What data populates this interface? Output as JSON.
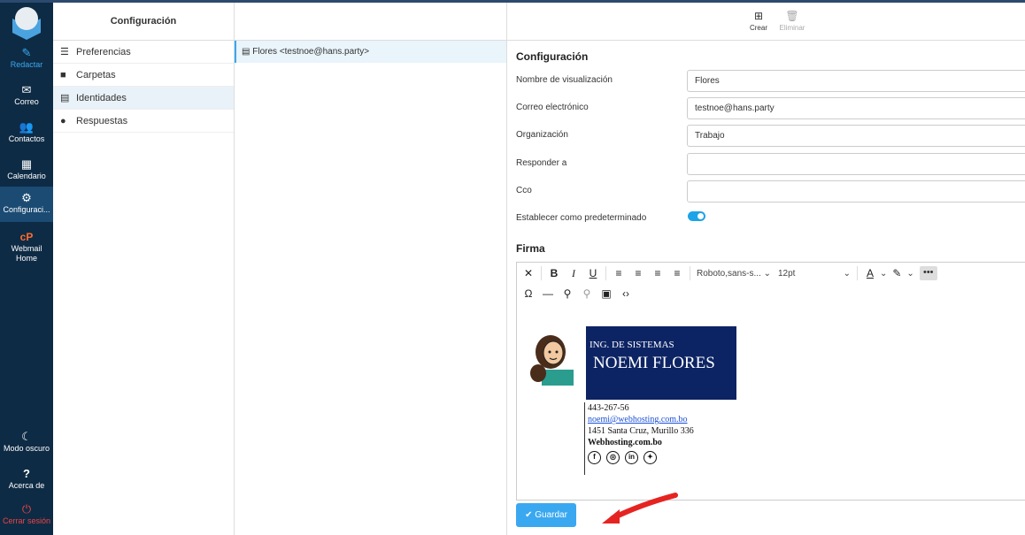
{
  "nav": {
    "items": [
      {
        "label": "Redactar",
        "icon": "compose-icon"
      },
      {
        "label": "Correo",
        "icon": "mail-icon"
      },
      {
        "label": "Contactos",
        "icon": "contacts-icon"
      },
      {
        "label": "Calendario",
        "icon": "calendar-icon"
      },
      {
        "label": "Configuraci...",
        "icon": "gear-icon"
      },
      {
        "label": "Webmail Home",
        "icon": "cpanel-icon"
      }
    ],
    "bottom": [
      {
        "label": "Modo oscuro",
        "icon": "moon-icon"
      },
      {
        "label": "Acerca de",
        "icon": "help-icon"
      },
      {
        "label": "Cerrar sesión",
        "icon": "power-icon"
      }
    ]
  },
  "settings": {
    "title": "Configuración",
    "items": [
      "Preferencias",
      "Carpetas",
      "Identidades",
      "Respuestas"
    ]
  },
  "identities": {
    "items": [
      "Flores <testnoe@hans.party>"
    ]
  },
  "toolbar": {
    "create_label": "Crear",
    "delete_label": "Eliminar"
  },
  "form": {
    "title": "Configuración",
    "fields": [
      {
        "label": "Nombre de visualización",
        "value": "Flores"
      },
      {
        "label": "Correo electrónico",
        "value": "testnoe@hans.party"
      },
      {
        "label": "Organización",
        "value": "Trabajo"
      },
      {
        "label": "Responder a",
        "value": ""
      },
      {
        "label": "Cco",
        "value": ""
      }
    ],
    "default_label": "Establecer como predeterminado",
    "default_on": true,
    "signature_title": "Firma",
    "save_label": "Guardar"
  },
  "editor": {
    "font_family": "Roboto,sans-s...",
    "font_size": "12pt"
  },
  "signature": {
    "role": "ING. DE SISTEMAS",
    "name": "NOEMI FLORES",
    "phone": "443-267-56",
    "email": "noemi@webhosting.com.bo",
    "address": "1451 Santa Cruz, Murillo 336",
    "company": "Webhosting.com.bo",
    "banner_color": "#0d2464"
  },
  "colors": {
    "nav_bg": "#0e2b45",
    "accent": "#39a8f0",
    "logout": "#ee4444"
  }
}
